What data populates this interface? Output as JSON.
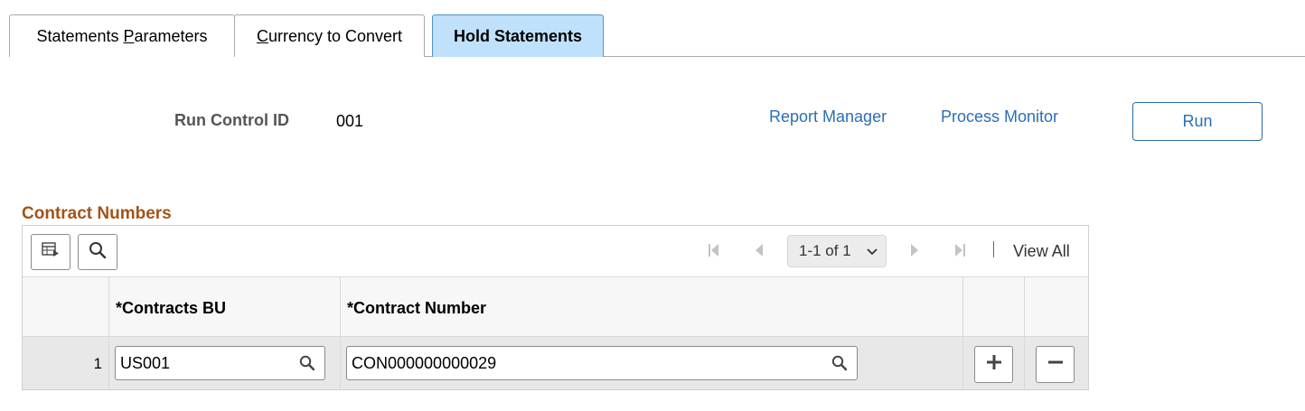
{
  "tabs": [
    {
      "pre": "Statements ",
      "key": "P",
      "post": "arameters"
    },
    {
      "pre": "",
      "key": "C",
      "post": "urrency to Convert"
    },
    {
      "label": "Hold Statements"
    }
  ],
  "run_control": {
    "label": "Run Control ID",
    "value": "001",
    "report_manager": "Report Manager",
    "process_monitor": "Process Monitor",
    "run_button": "Run"
  },
  "grid": {
    "title": "Contract Numbers",
    "pager_text": "1-1 of 1",
    "view_all": "View All",
    "columns": [
      "*Contracts BU",
      "*Contract Number"
    ],
    "rows": [
      {
        "num": "1",
        "business_unit": "US001",
        "contract_number": "CON000000000029"
      }
    ]
  },
  "colors": {
    "active_tab": "#bfe1fc",
    "link": "#2a6eb8",
    "grid_title": "#a3541a"
  },
  "icons": [
    "personalize-grid-icon",
    "find-icon",
    "first-page-icon",
    "previous-page-icon",
    "chevron-down-icon",
    "next-page-icon",
    "last-page-icon",
    "lookup-icon",
    "add-row-icon",
    "delete-row-icon"
  ]
}
